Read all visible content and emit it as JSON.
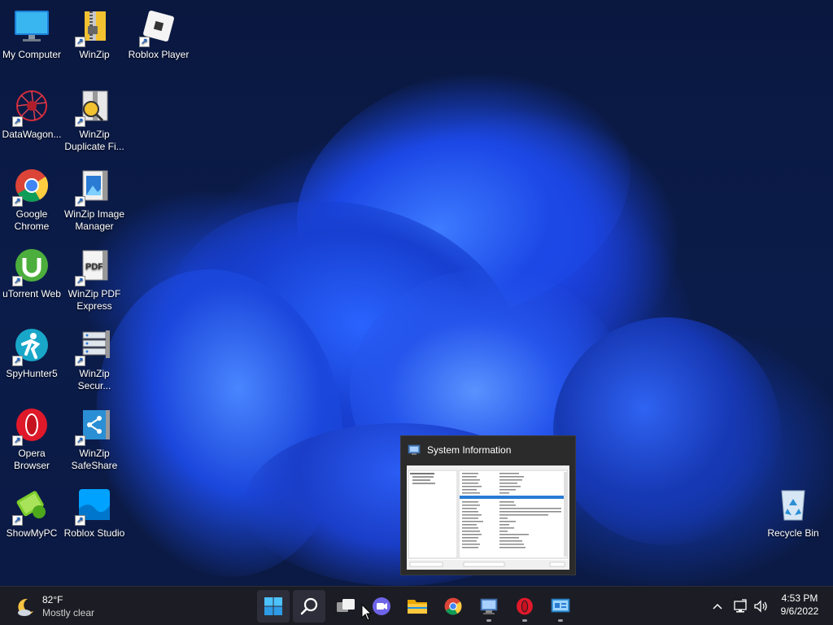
{
  "desktop": {
    "icons": [
      {
        "label": "My Computer"
      },
      {
        "label": "WinZip"
      },
      {
        "label": "Roblox Player"
      },
      {
        "label": "DataWagon..."
      },
      {
        "label": "WinZip Duplicate Fi..."
      },
      {
        "label": "Google Chrome"
      },
      {
        "label": "WinZip Image Manager"
      },
      {
        "label": "uTorrent Web"
      },
      {
        "label": "WinZip PDF Express"
      },
      {
        "label": "SpyHunter5"
      },
      {
        "label": "WinZip Secur..."
      },
      {
        "label": "Opera Browser"
      },
      {
        "label": "WinZip SafeShare"
      },
      {
        "label": "ShowMyPC"
      },
      {
        "label": "Roblox Studio"
      },
      {
        "label": "Recycle Bin"
      }
    ]
  },
  "preview": {
    "title": "System Information"
  },
  "taskbar": {
    "weather": {
      "temp": "82°F",
      "condition": "Mostly clear"
    },
    "apps": [
      {
        "icon": "start-icon"
      },
      {
        "icon": "search-icon"
      },
      {
        "icon": "task-view-icon"
      },
      {
        "icon": "teams-chat-icon"
      },
      {
        "icon": "file-explorer-icon"
      },
      {
        "icon": "chrome-icon"
      },
      {
        "icon": "system-information-icon"
      },
      {
        "icon": "opera-icon"
      },
      {
        "icon": "control-panel-icon"
      }
    ],
    "clock": {
      "time": "4:53 PM",
      "date": "9/6/2022"
    }
  },
  "colors": {
    "taskbar_bg": "#1c1c24",
    "desktop_bg": "#0b1c4a",
    "accent": "#1f6feb"
  }
}
